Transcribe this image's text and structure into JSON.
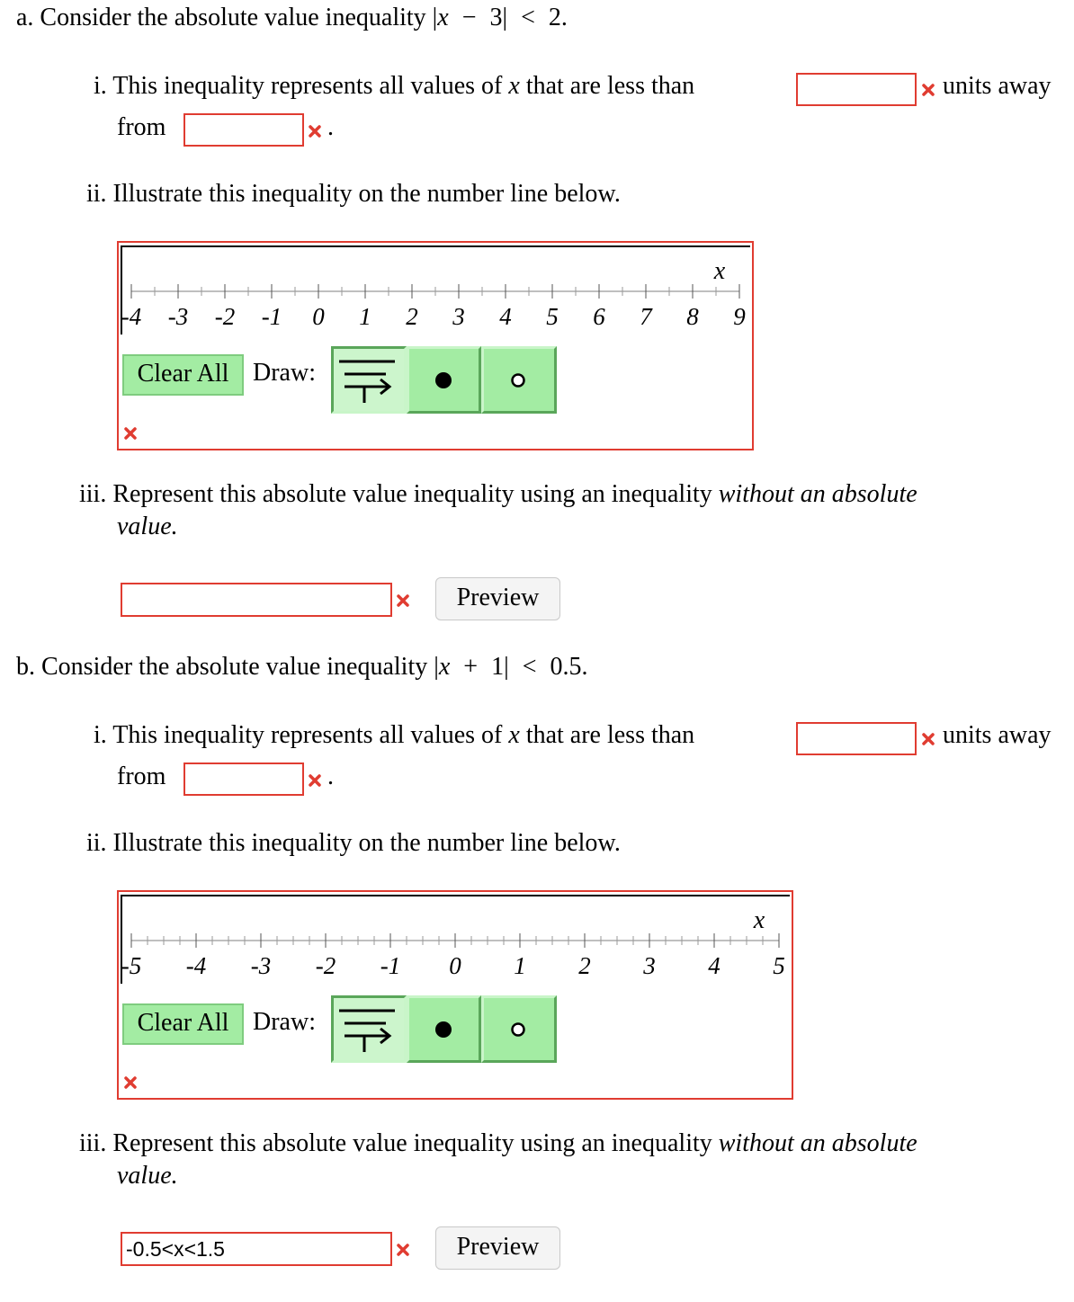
{
  "colors": {
    "error_red": "#e03c31",
    "tool_green": "#a3eca3",
    "tool_active_green": "#ccf5cc",
    "preview_bg": "#f4f4f4"
  },
  "part_a": {
    "heading_prefix": "a. Consider the absolute value inequality ",
    "inequality_math": "|x − 3| < 2.",
    "q1": {
      "text_before": "i. This inequality represents all values of ",
      "var": "x",
      "text_mid": " that are less than",
      "after_box1": "units away",
      "text_from": "from",
      "after_box2": ".",
      "box1_value": "",
      "box2_value": "",
      "box1_status": "incorrect-icon",
      "box2_status": "incorrect-icon"
    },
    "q2": {
      "text": "ii. Illustrate this inequality on the number line below.",
      "numberline": {
        "axis_label": "x",
        "min": -4,
        "max": 9,
        "minor_step": 0.5,
        "tick_labels": [
          "-4",
          "-3",
          "-2",
          "-1",
          "0",
          "1",
          "2",
          "3",
          "4",
          "5",
          "6",
          "7",
          "8",
          "9"
        ]
      },
      "clear_all_label": "Clear All",
      "draw_label": "Draw:",
      "tools": [
        {
          "name": "ray-tool",
          "active": true
        },
        {
          "name": "closed-point-tool",
          "active": false
        },
        {
          "name": "open-point-tool",
          "active": false
        }
      ],
      "status": "incorrect-icon"
    },
    "q3": {
      "text_before": "iii. Represent this absolute value inequality using an inequality ",
      "text_italic": "without an absolute",
      "text_line2": "value.",
      "input_value": "",
      "status": "incorrect-icon",
      "preview_label": "Preview"
    }
  },
  "part_b": {
    "heading_prefix": "b. Consider the absolute value inequality ",
    "inequality_math": "|x + 1| < 0.5.",
    "q1": {
      "text_before": "i. This inequality represents all values of ",
      "var": "x",
      "text_mid": " that are less than",
      "after_box1": "units away",
      "text_from": "from",
      "after_box2": ".",
      "box1_value": "",
      "box2_value": "",
      "box1_status": "incorrect-icon",
      "box2_status": "incorrect-icon"
    },
    "q2": {
      "text": "ii. Illustrate this inequality on the number line below.",
      "numberline": {
        "axis_label": "x",
        "min": -5,
        "max": 5,
        "minor_step": 0.25,
        "tick_labels": [
          "-5",
          "-4",
          "-3",
          "-2",
          "-1",
          "0",
          "1",
          "2",
          "3",
          "4",
          "5"
        ]
      },
      "clear_all_label": "Clear All",
      "draw_label": "Draw:",
      "tools": [
        {
          "name": "ray-tool",
          "active": true
        },
        {
          "name": "closed-point-tool",
          "active": false
        },
        {
          "name": "open-point-tool",
          "active": false
        }
      ],
      "status": "incorrect-icon"
    },
    "q3": {
      "text_before": "iii. Represent this absolute value inequality using an inequality ",
      "text_italic": "without an absolute",
      "text_line2": "value.",
      "input_value": "-0.5<x<1.5",
      "status": "incorrect-icon",
      "preview_label": "Preview"
    }
  }
}
